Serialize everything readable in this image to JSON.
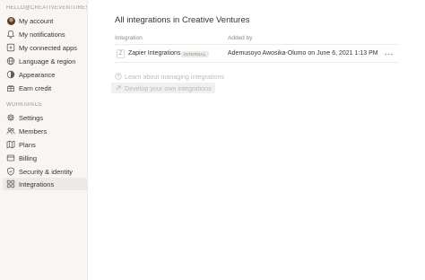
{
  "sidebar": {
    "account_header": "HELLO@CREATIVEVENTURES...",
    "account_items": [
      {
        "label": "My account",
        "icon": "avatar"
      },
      {
        "label": "My notifications",
        "icon": "bell-icon"
      },
      {
        "label": "My connected apps",
        "icon": "app-square-icon"
      },
      {
        "label": "Language & region",
        "icon": "globe-icon"
      },
      {
        "label": "Appearance",
        "icon": "half-circle-icon"
      },
      {
        "label": "Earn credit",
        "icon": "gift-icon"
      }
    ],
    "workspace_header": "WORKSPACE",
    "workspace_items": [
      {
        "label": "Settings",
        "icon": "gear-icon"
      },
      {
        "label": "Members",
        "icon": "people-icon"
      },
      {
        "label": "Plans",
        "icon": "map-icon"
      },
      {
        "label": "Billing",
        "icon": "card-icon"
      },
      {
        "label": "Security & identity",
        "icon": "shield-icon"
      },
      {
        "label": "Integrations",
        "icon": "grid-icon",
        "active": true
      }
    ]
  },
  "main": {
    "title": "All integrations in Creative Ventures",
    "columns": {
      "integration": "Integration",
      "added_by": "Added by"
    },
    "rows": [
      {
        "logo": "Z",
        "name": "Zapier Integrations",
        "badge": "INTERNAL",
        "added_by": "Ademusoyo Awosika-Olumo on June 6, 2021 1:13 PM"
      }
    ],
    "links": {
      "learn": "Learn about managing integrations",
      "develop": "Develop your own integrations"
    }
  }
}
